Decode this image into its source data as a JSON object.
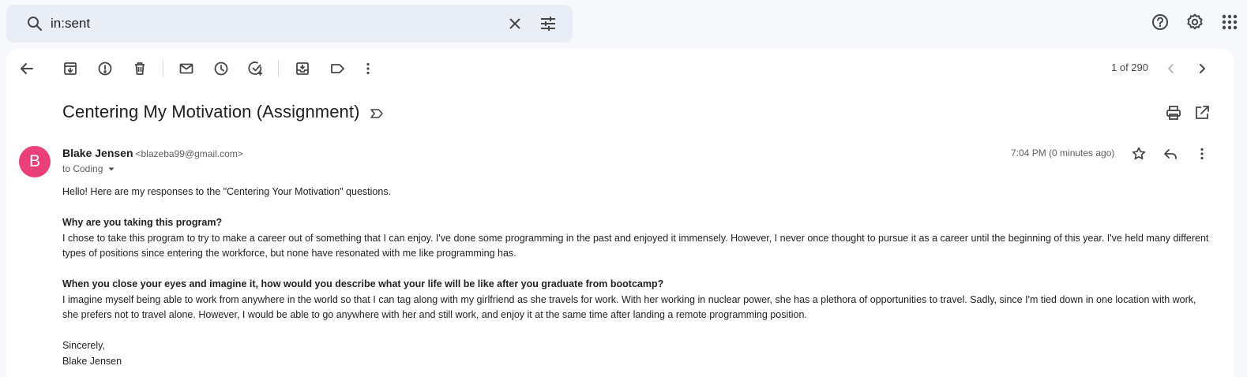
{
  "search": {
    "query": "in:sent"
  },
  "toolbar": {
    "pager": "1 of 290"
  },
  "email": {
    "subject": "Centering My Motivation (Assignment)",
    "avatar_initial": "B",
    "avatar_color": "#e94077",
    "sender_name": "Blake Jensen",
    "sender_email": "<blazeba99@gmail.com>",
    "recipient": "to Coding",
    "time": "7:04 PM (0 minutes ago)",
    "body": {
      "greeting": "Hello! Here are my responses to the \"Centering Your Motivation\" questions.",
      "q1": "Why are you taking this program?",
      "a1": "I chose to take this program to try to make a career out of something that I can enjoy. I've done some programming in the past and enjoyed it immensely. However, I never once thought to pursue it as a career until the beginning of this year. I've held many different types of positions since entering the workforce, but none have resonated with me like programming has.",
      "q2": "When you close your eyes and imagine it, how would you describe what your life will be like after you graduate from bootcamp?",
      "a2": "I imagine myself being able to work from anywhere in the world so that I can tag along with my girlfriend as she travels for work. With her working in nuclear power, she has a plethora of opportunities to travel. Sadly, since I'm tied down in one location with work, she prefers not to travel alone. However, I would be able to go anywhere with her and still work, and enjoy it at the same time after landing a remote programming position.",
      "closing": "Sincerely,",
      "signature": "Blake Jensen"
    }
  }
}
